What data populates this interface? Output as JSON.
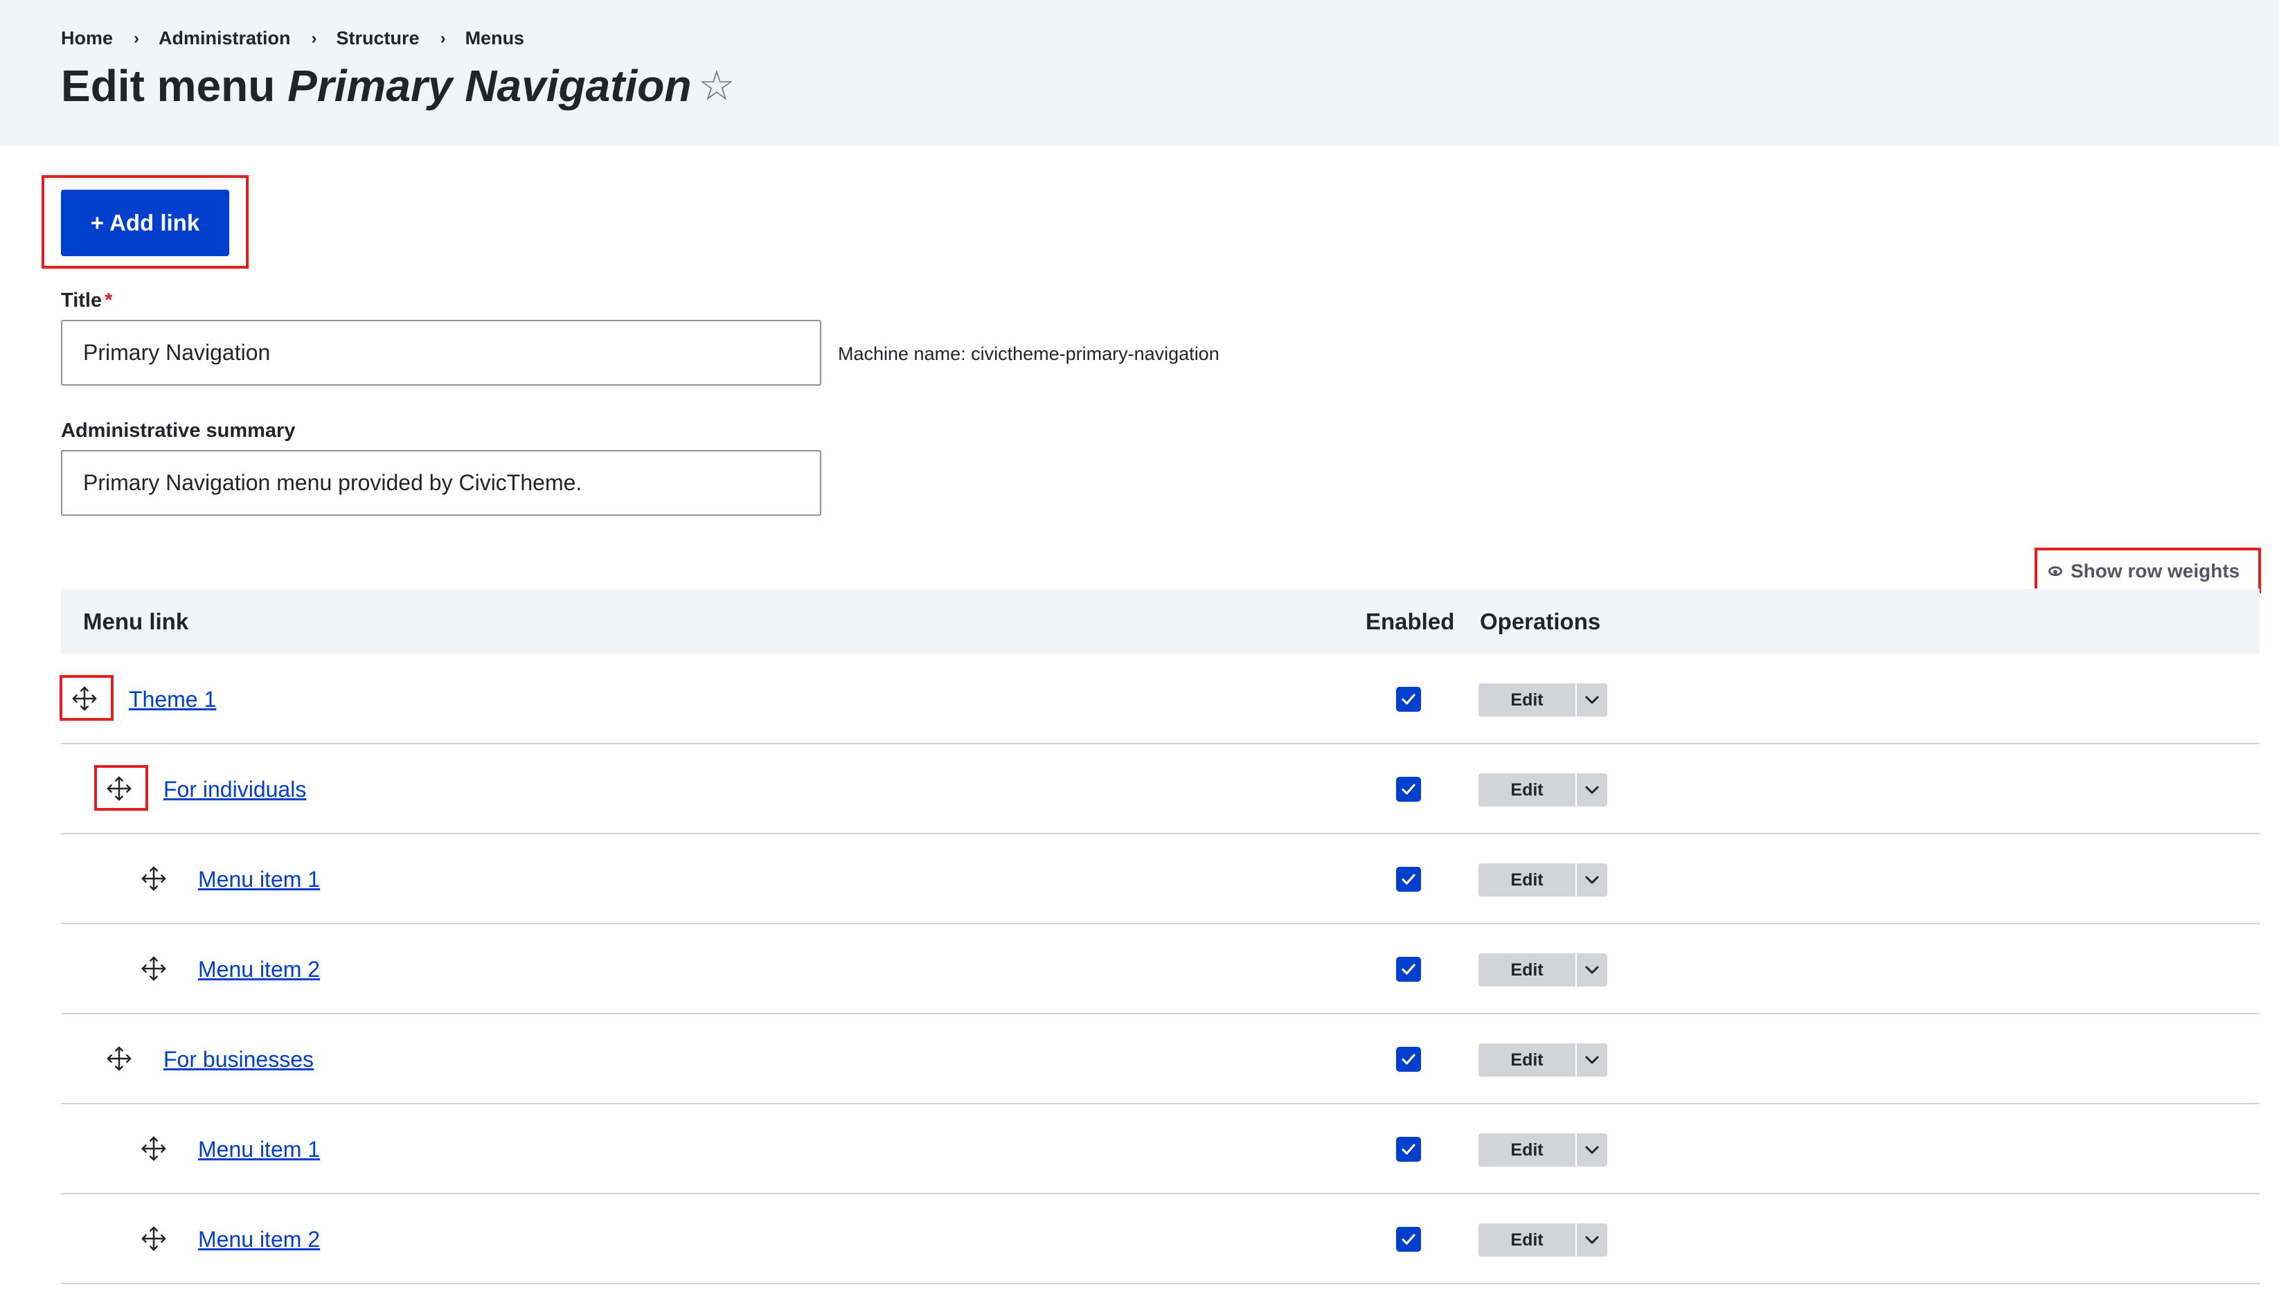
{
  "breadcrumb": [
    "Home",
    "Administration",
    "Structure",
    "Menus"
  ],
  "breadcrumb_separator": "›",
  "page": {
    "title_prefix": "Edit menu",
    "title_menu": "Primary Navigation",
    "star": "☆"
  },
  "actions": {
    "add_link": "+ Add link"
  },
  "form": {
    "title_label": "Title",
    "required_mark": "*",
    "title_value": "Primary Navigation",
    "machine_name": "Machine name: civictheme-primary-navigation",
    "summary_label": "Administrative summary",
    "summary_value": "Primary Navigation menu provided by CivicTheme."
  },
  "table": {
    "show_row_weights": "Show row weights",
    "columns": {
      "menu_link": "Menu link",
      "enabled": "Enabled",
      "operations": "Operations"
    },
    "rows": [
      {
        "label": "Theme 1",
        "depth": 0,
        "enabled": true,
        "operation": "Edit"
      },
      {
        "label": "For individuals",
        "depth": 1,
        "enabled": true,
        "operation": "Edit"
      },
      {
        "label": "Menu item 1",
        "depth": 2,
        "enabled": true,
        "operation": "Edit"
      },
      {
        "label": "Menu item 2",
        "depth": 2,
        "enabled": true,
        "operation": "Edit"
      },
      {
        "label": "For businesses",
        "depth": 1,
        "enabled": true,
        "operation": "Edit"
      },
      {
        "label": "Menu item 1",
        "depth": 2,
        "enabled": true,
        "operation": "Edit"
      },
      {
        "label": "Menu item 2",
        "depth": 2,
        "enabled": true,
        "operation": "Edit"
      }
    ]
  },
  "icons": {
    "drag": "move-arrows-icon",
    "checkbox": "checkmark-icon",
    "dropdown": "chevron-down-icon",
    "visibility": "eye-icon",
    "favorite": "star-outline-icon"
  },
  "colors": {
    "header_bg": "#f3f4f9",
    "primary": "#003ecc",
    "link": "#003ecc",
    "highlight": "#e02020",
    "button_secondary": "#d3d4d9",
    "required": "#d72222"
  }
}
